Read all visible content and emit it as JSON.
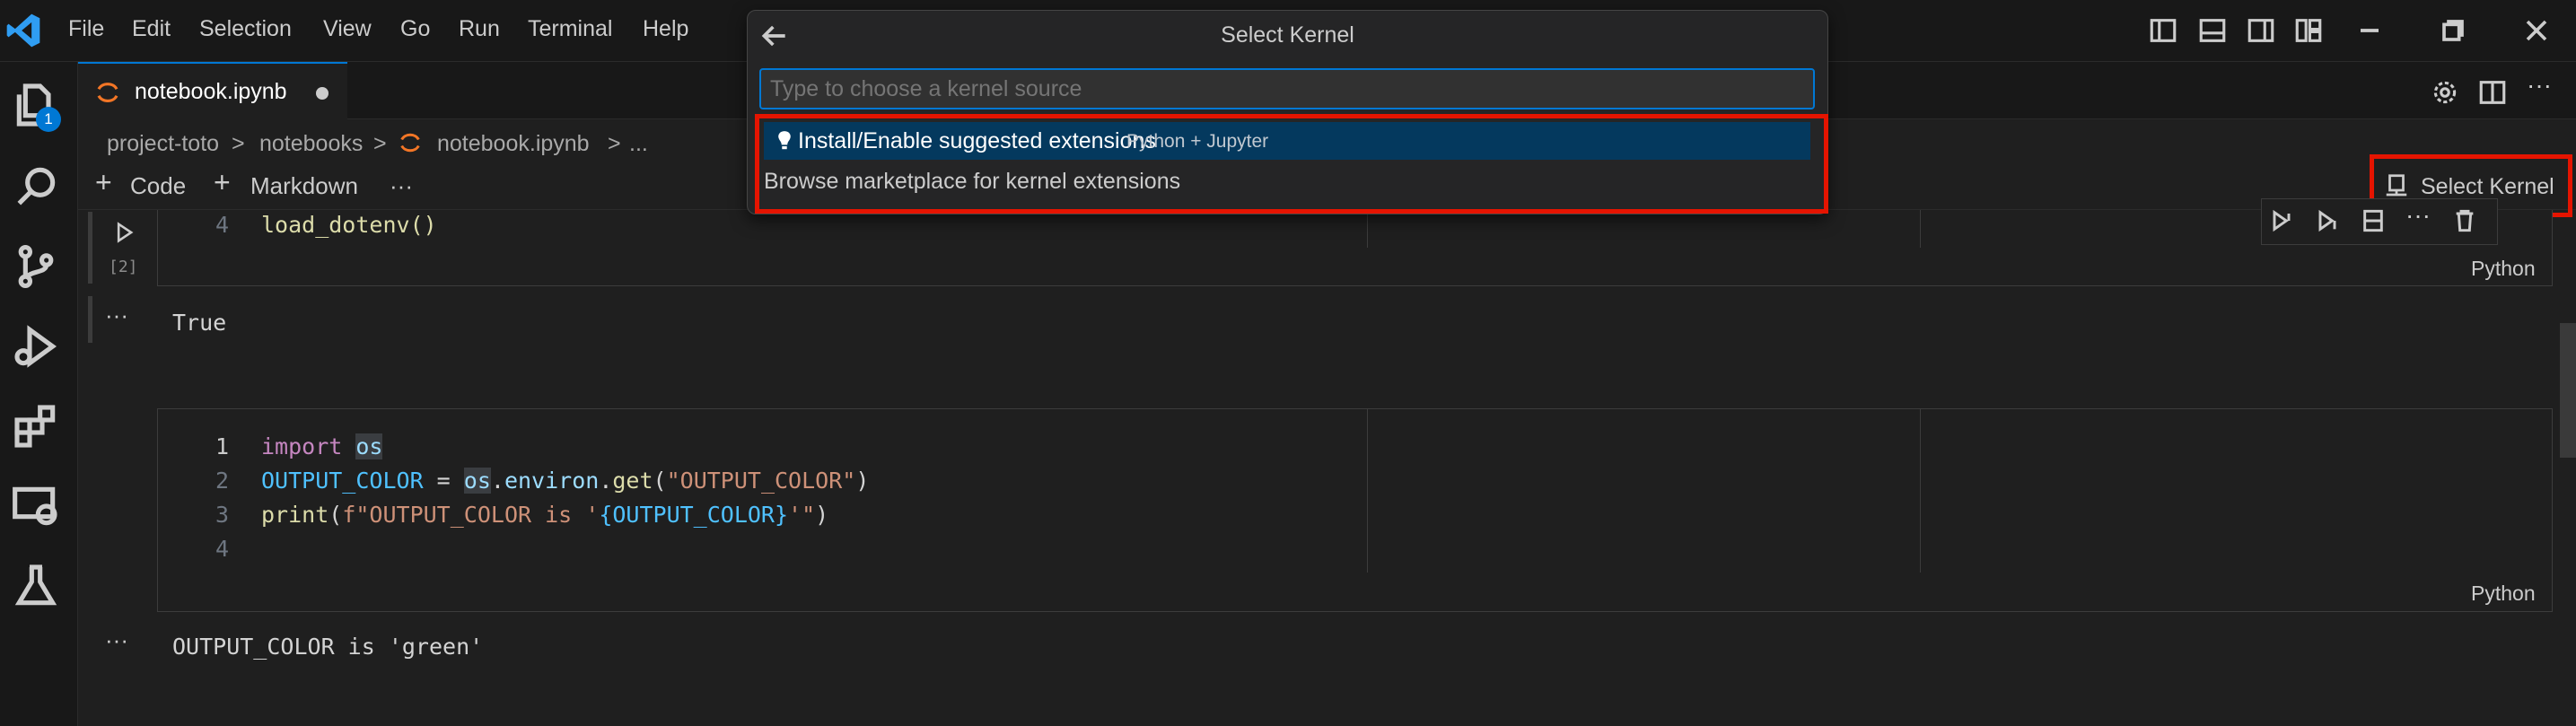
{
  "menu": [
    "File",
    "Edit",
    "Selection",
    "View",
    "Go",
    "Run",
    "Terminal",
    "Help"
  ],
  "activity_badge": "1",
  "tab": {
    "label": "notebook.ipynb"
  },
  "breadcrumb": [
    "project-toto",
    ">",
    "notebooks",
    ">",
    "notebook.ipynb",
    ">",
    "..."
  ],
  "toolbar": {
    "code_label": "Code",
    "markdown_label": "Markdown",
    "more": "···"
  },
  "kernel_button": {
    "label": "Select Kernel"
  },
  "quick_pick": {
    "title": "Select Kernel",
    "placeholder": "Type to choose a kernel source",
    "items": [
      {
        "label": "Install/Enable suggested extensions",
        "description": "Python + Jupyter"
      },
      {
        "label": "Browse marketplace for kernel extensions"
      }
    ]
  },
  "cells": [
    {
      "exec_count": "[2]",
      "lines": [
        {
          "num": "4",
          "text": "load_dotenv()"
        }
      ],
      "language": "Python",
      "output_marker": "···",
      "output": "True"
    },
    {
      "lines": [
        {
          "num": "1",
          "text": "import os"
        },
        {
          "num": "2",
          "text": "OUTPUT_COLOR = os.environ.get(\"OUTPUT_COLOR\")"
        },
        {
          "num": "3",
          "text": "print(f\"OUTPUT_COLOR is '{OUTPUT_COLOR}'\")"
        },
        {
          "num": "4",
          "text": ""
        }
      ],
      "language": "Python",
      "output_marker": "···",
      "output": "OUTPUT_COLOR is 'green'"
    }
  ],
  "colors": {
    "accent": "#0078d4",
    "highlight_border": "#e51400",
    "selected_item": "#04395e"
  }
}
